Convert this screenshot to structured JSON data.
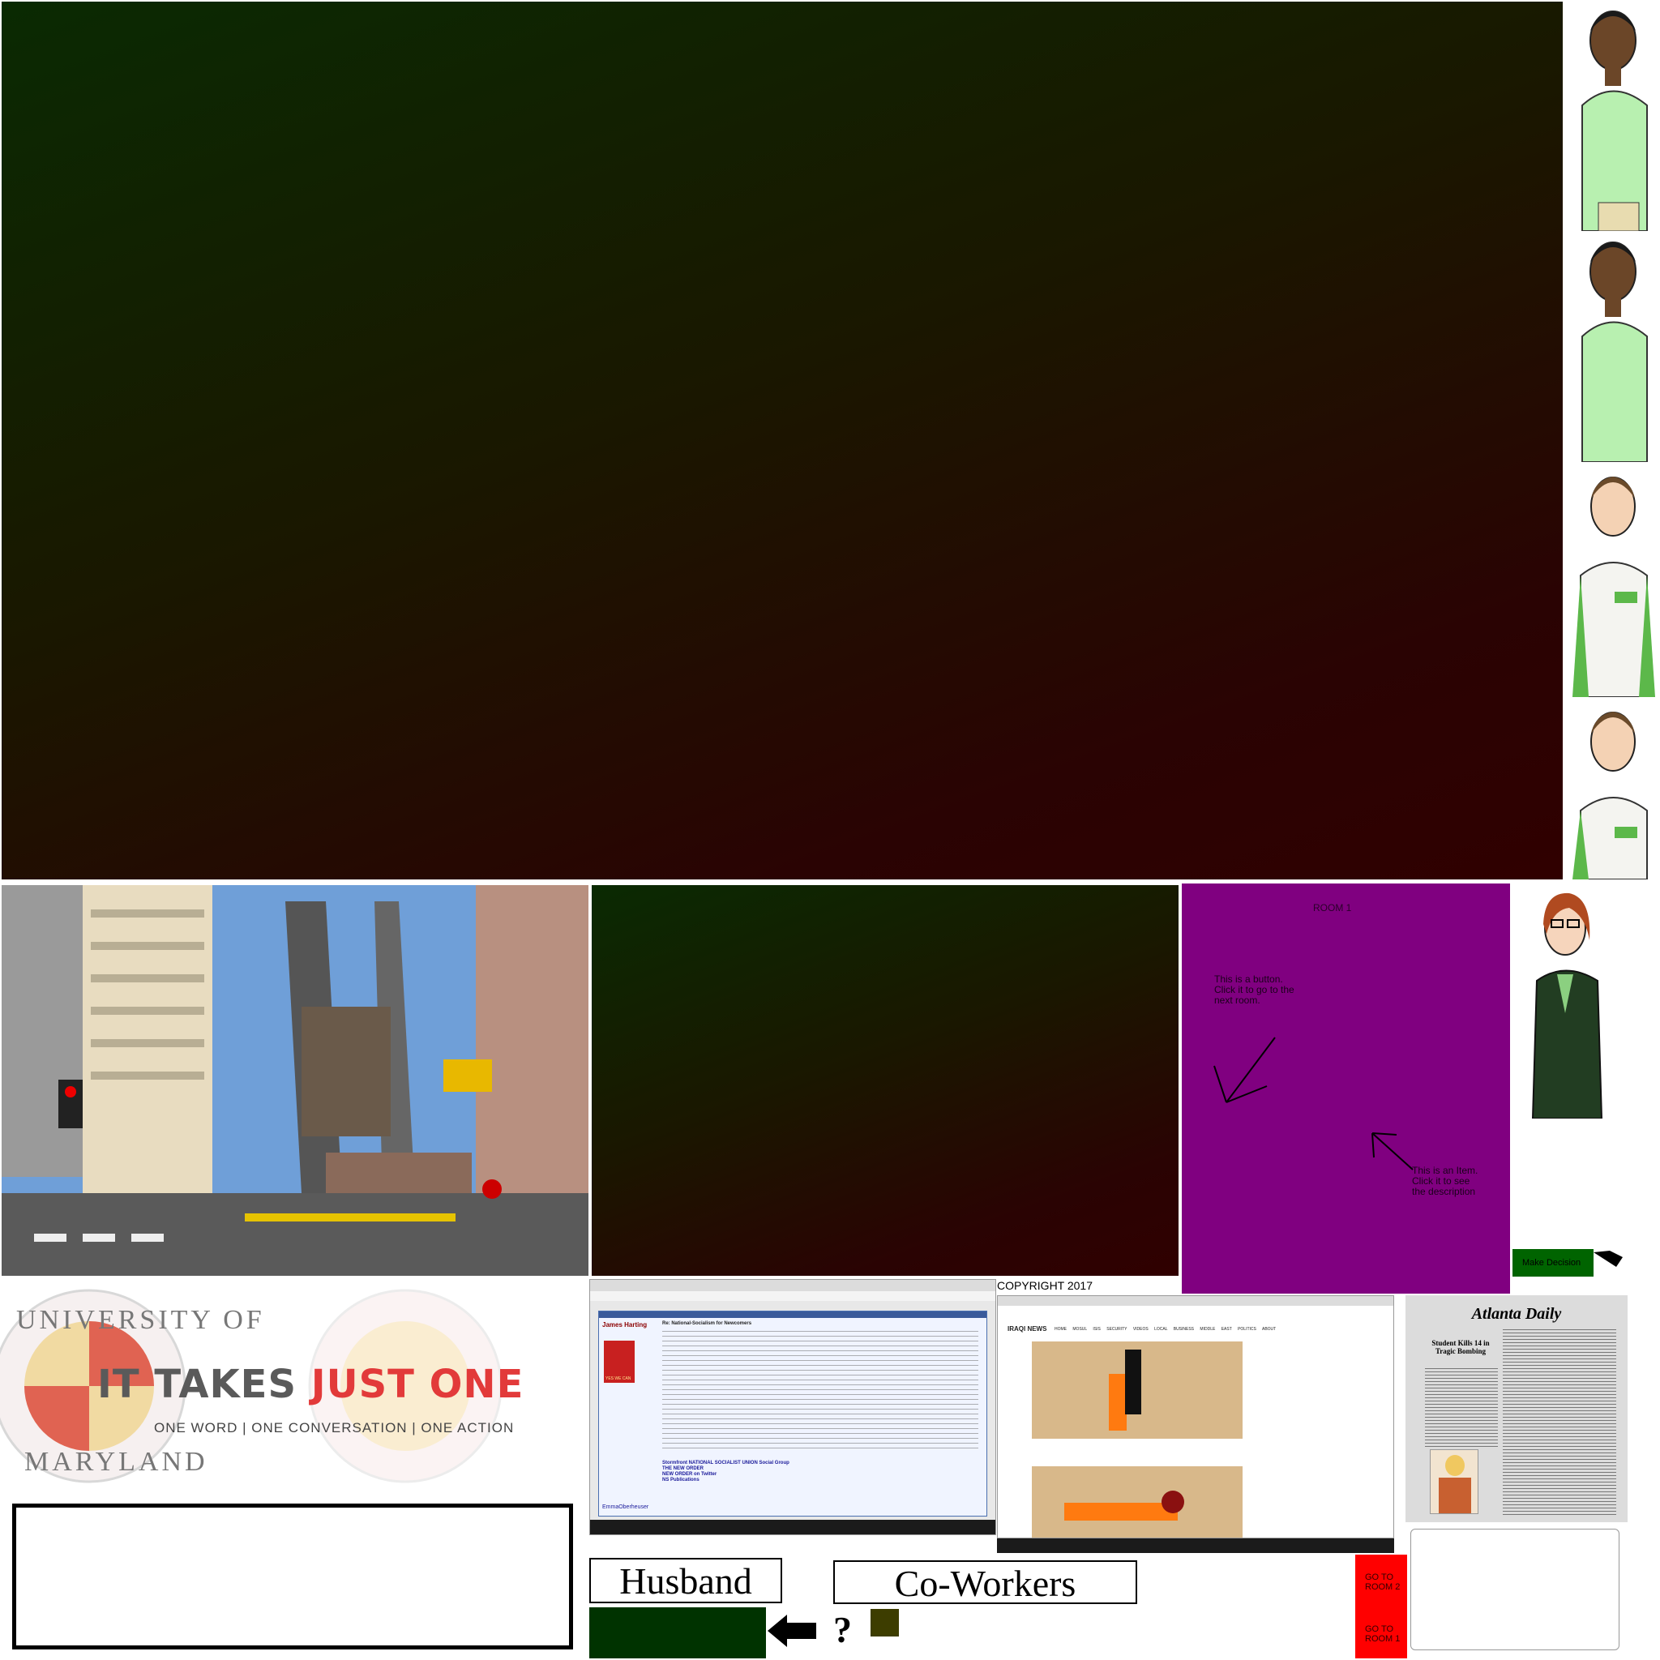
{
  "scene": {
    "room_title": "ROOM 1",
    "copyright": "COPYRIGHT 2017"
  },
  "hints": {
    "button_hint": "This is a button.\nClick it to go to the\nnext room.",
    "item_hint": "This is an Item.\nClick it to see\nthe description"
  },
  "buttons": {
    "make_decision": "Make Decision",
    "husband": "Husband",
    "coworkers": "Co-Workers",
    "question_mark": "?",
    "go_room_2": "GO TO\nROOM 2",
    "go_room_1": "GO TO\nROOM 1"
  },
  "logo": {
    "part1": "IT TAKES ",
    "part2": "JUST ONE",
    "tagline": "ONE WORD | ONE CONVERSATION | ONE ACTION",
    "seal_top": "UNIVERSITY OF",
    "seal_bottom": "MARYLAND"
  },
  "forum_screenshot": {
    "username": "James Harting",
    "post_title": "Re: National-Socialism for Newcomers",
    "second_user": "EmmaOberheuser",
    "yes_we_can": "YES WE CAN",
    "links": [
      "Stormfront NATIONAL SOCIALIST UNION Social Group",
      "THE NEW ORDER",
      "NEW ORDER on Twitter",
      "NS Publications"
    ]
  },
  "news_screenshot": {
    "site_logo": "IRAQI NEWS",
    "nav": [
      "HOME",
      "MOSUL",
      "ISIS",
      "SECURITY",
      "VIDEOS",
      "LOCAL",
      "BUSINESS",
      "MIDDLE EAST",
      "POLITICS",
      "ABOUT"
    ]
  },
  "newspaper": {
    "masthead": "Atlanta Daily",
    "headline": "Student Kills 14 in Tragic Bombing"
  },
  "colors": {
    "room_purple": "#800080",
    "decision_green": "#006400",
    "dark_green_block": "#003300",
    "olive_block": "#3d3d00",
    "go_red": "#ff0000"
  }
}
